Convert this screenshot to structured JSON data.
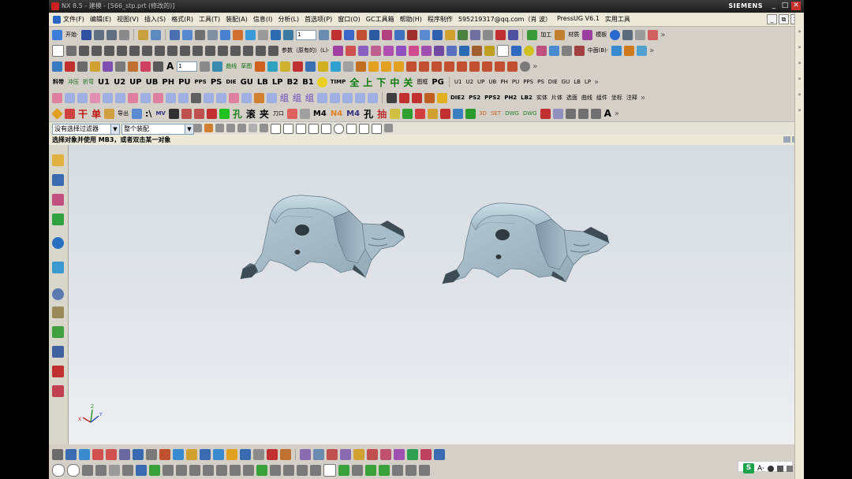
{
  "window": {
    "title": "NX 8.5 - 建模 - [566_stp.prt (修改的)]",
    "brand": "SIEMENS",
    "controls": [
      "_",
      "□",
      "✕"
    ]
  },
  "menu": {
    "items": [
      "文件(F)",
      "编辑(E)",
      "视图(V)",
      "插入(S)",
      "格式(R)",
      "工具(T)",
      "装配(A)",
      "信息(I)",
      "分析(L)",
      "首选项(P)",
      "窗口(O)",
      "GC工具箱",
      "帮助(H)",
      "程序制作",
      "595219317@qq.com（肖 波）",
      "PressUG V6.1",
      "实用工具"
    ],
    "right_controls": [
      "_",
      "⧉",
      "✕"
    ]
  },
  "toolbar1": {
    "start_label": "开始·",
    "layer_value": "1",
    "right_labels": [
      "加工",
      "材质",
      "模板"
    ]
  },
  "toolbar2": {
    "param_label": "参数（原有的）(L)·",
    "center_label": "中面(B)·"
  },
  "toolbar3": {
    "layer_value": "1",
    "labels": [
      "曲线",
      "草图"
    ]
  },
  "toolbar4": {
    "labels": [
      "料带",
      "冲压",
      "折弯",
      "U1",
      "U2",
      "UP",
      "UB",
      "PH",
      "PU",
      "PPS",
      "PS",
      "DIE",
      "GU",
      "LB",
      "LP",
      "B2",
      "B1",
      "TIMP",
      "全",
      "上",
      "下",
      "中",
      "关",
      "图框",
      "PG",
      "U1",
      "U2",
      "UP",
      "UB",
      "PH",
      "PU",
      "PPS",
      "PS",
      "DIE",
      "GU",
      "LB",
      "LP"
    ]
  },
  "toolbar5": {
    "labels": [
      "DIE2",
      "PS2",
      "PPS2",
      "PH2",
      "LB2",
      "实体",
      "片体",
      "选面",
      "曲线",
      "组件",
      "坐标",
      "注释"
    ],
    "cjk_labels": [
      "组",
      "组",
      "组"
    ]
  },
  "toolbar6": {
    "labels": [
      "干",
      "单",
      "导出",
      "MV",
      "孔",
      "滚",
      "夹",
      "刀口",
      "M4",
      "N4",
      "M4",
      "孔",
      "抽",
      "SET",
      "DWG",
      "DWG",
      "3D",
      "A"
    ]
  },
  "selection_bar": {
    "filter_value": "没有选择过滤器",
    "scope_value": "整个装配"
  },
  "status": {
    "prompt": "选择对象并使用 MB3，或者双击某一对象"
  },
  "triad": {
    "x": "X",
    "y": "Y",
    "z": "Z"
  },
  "tray": {
    "s_icon": "S",
    "text": "A·"
  },
  "colors": {
    "title_bar": "#222222",
    "menu_bg": "#ece9d8",
    "toolbar_bg": "#d4d0c8",
    "viewport_top": "#d5dbe2",
    "viewport_bottom": "#edeff1",
    "part_light": "#b7cdd8",
    "part_mid": "#8fa9b8",
    "part_dark": "#4a5a64"
  }
}
